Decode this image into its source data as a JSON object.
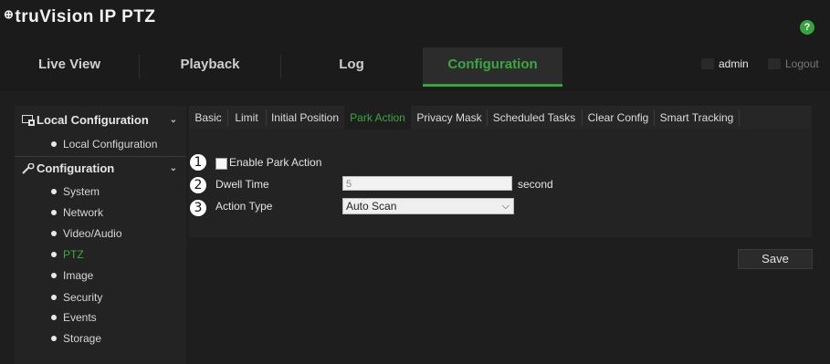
{
  "header": {
    "logo_mark": "⊕",
    "logo_text": "truVision  IP PTZ",
    "help_label": "?",
    "user_label": "admin",
    "logout_label": "Logout"
  },
  "nav": {
    "tabs": [
      {
        "label": "Live View",
        "active": false
      },
      {
        "label": "Playback",
        "active": false
      },
      {
        "label": "Log",
        "active": false
      },
      {
        "label": "Configuration",
        "active": true
      }
    ]
  },
  "sidebar": {
    "sections": [
      {
        "title": "Local Configuration",
        "icon": "monitor-icon",
        "items": [
          "Local Configuration"
        ]
      },
      {
        "title": "Configuration",
        "icon": "wrench-icon",
        "items": [
          "System",
          "Network",
          "Video/Audio",
          "PTZ",
          "Image",
          "Security",
          "Events",
          "Storage"
        ]
      }
    ],
    "active_item": "PTZ",
    "chevron": "⌄"
  },
  "tabs": [
    "Basic",
    "Limit",
    "Initial Position",
    "Park Action",
    "Privacy Mask",
    "Scheduled Tasks",
    "Clear Config",
    "Smart Tracking"
  ],
  "active_tab": "Park Action",
  "form": {
    "callouts": [
      "1",
      "2",
      "3"
    ],
    "enable_label": "Enable Park Action",
    "enable_checked": false,
    "dwell_label": "Dwell Time",
    "dwell_value": "5",
    "dwell_unit": "second",
    "action_label": "Action Type",
    "action_value": "Auto Scan",
    "action_arrow": "⌵"
  },
  "save_label": "Save",
  "colors": {
    "accent": "#37a33c",
    "background": "#1e1e1e"
  }
}
